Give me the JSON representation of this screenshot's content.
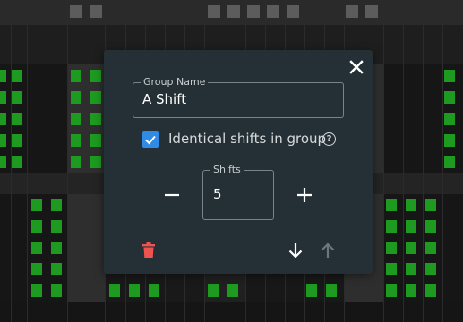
{
  "dialog": {
    "group_name_label": "Group Name",
    "group_name_value": "A Shift",
    "identical_label": "Identical shifts in group",
    "identical_checked": true,
    "help_glyph": "?",
    "shifts_label": "Shifts",
    "shifts_value": "5"
  },
  "icons": {
    "close": "close-icon",
    "help": "help-circle-icon",
    "decrement": "minus-icon",
    "increment": "plus-icon",
    "delete": "trash-icon",
    "move_down": "arrow-down-icon",
    "move_up": "arrow-up-icon"
  },
  "colors": {
    "dialog_bg": "#253036",
    "checkbox": "#2f8be6",
    "delete": "#ef5350",
    "shift_block": "#1d9a1f",
    "disabled_icon": "#6e767b"
  }
}
